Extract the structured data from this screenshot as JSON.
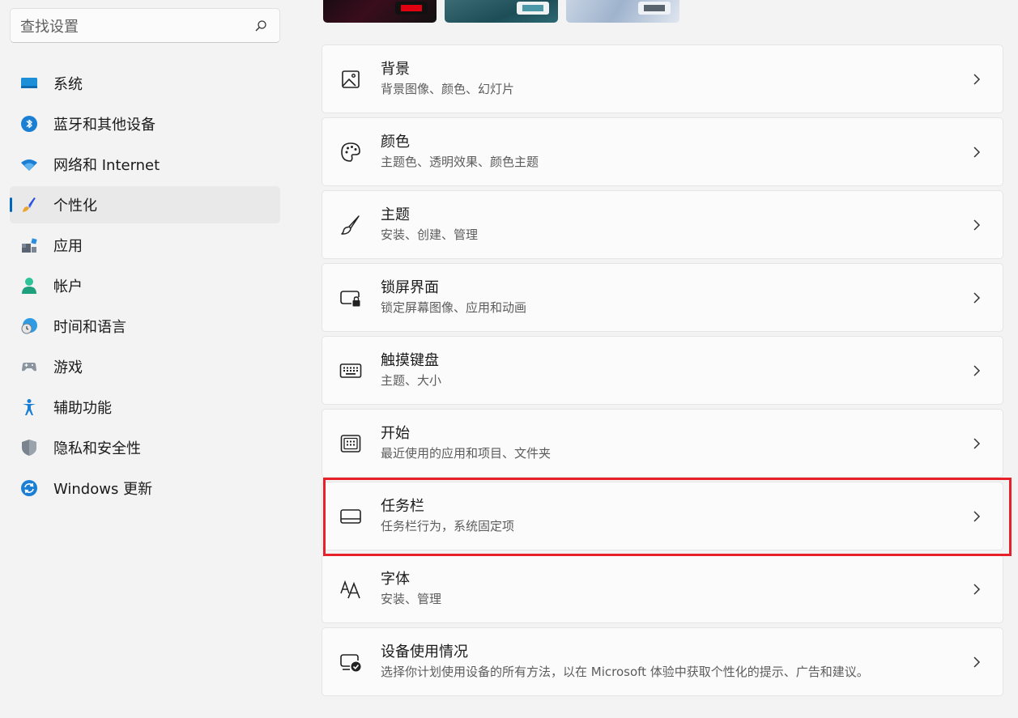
{
  "search": {
    "placeholder": "查找设置",
    "icon": "search-icon"
  },
  "sidebar": {
    "items": [
      {
        "label": "系统",
        "icon": "system-icon"
      },
      {
        "label": "蓝牙和其他设备",
        "icon": "bluetooth-icon"
      },
      {
        "label": "网络和 Internet",
        "icon": "wifi-icon"
      },
      {
        "label": "个性化",
        "icon": "brush-icon",
        "active": true
      },
      {
        "label": "应用",
        "icon": "apps-icon"
      },
      {
        "label": "帐户",
        "icon": "account-icon"
      },
      {
        "label": "时间和语言",
        "icon": "clock-globe-icon"
      },
      {
        "label": "游戏",
        "icon": "gamepad-icon"
      },
      {
        "label": "辅助功能",
        "icon": "accessibility-icon"
      },
      {
        "label": "隐私和安全性",
        "icon": "shield-icon"
      },
      {
        "label": "Windows 更新",
        "icon": "update-icon"
      }
    ]
  },
  "main": {
    "cards": [
      {
        "title": "背景",
        "subtitle": "背景图像、颜色、幻灯片",
        "icon": "image-icon"
      },
      {
        "title": "颜色",
        "subtitle": "主题色、透明效果、颜色主题",
        "icon": "palette-icon"
      },
      {
        "title": "主题",
        "subtitle": "安装、创建、管理",
        "icon": "brush-icon"
      },
      {
        "title": "锁屏界面",
        "subtitle": "锁定屏幕图像、应用和动画",
        "icon": "lockscreen-icon"
      },
      {
        "title": "触摸键盘",
        "subtitle": "主题、大小",
        "icon": "keyboard-icon"
      },
      {
        "title": "开始",
        "subtitle": "最近使用的应用和项目、文件夹",
        "icon": "start-icon"
      },
      {
        "title": "任务栏",
        "subtitle": "任务栏行为，系统固定项",
        "icon": "taskbar-icon"
      },
      {
        "title": "字体",
        "subtitle": "安装、管理",
        "icon": "font-icon"
      },
      {
        "title": "设备使用情况",
        "subtitle": "选择你计划使用设备的所有方法，以在 Microsoft 体验中获取个性化的提示、广告和建议。",
        "icon": "device-usage-icon"
      }
    ]
  },
  "colors": {
    "accent": "#0067c0",
    "highlight": "#e8202a"
  }
}
